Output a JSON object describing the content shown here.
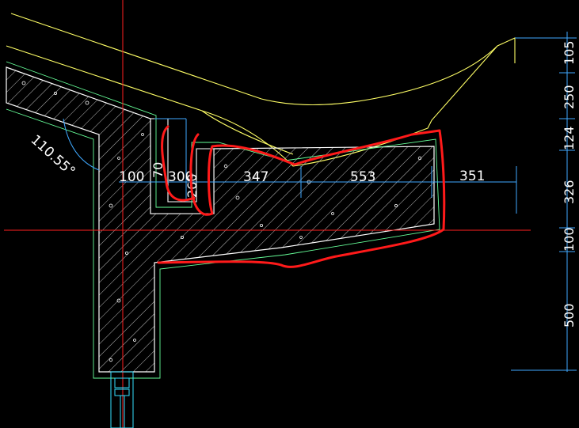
{
  "drawing": {
    "angle_label": "110.55°",
    "dims_horizontal": {
      "d100": "100",
      "d300": "300",
      "d347": "347",
      "d553": "553",
      "d351": "351"
    },
    "dims_vertical_small": {
      "d70": "70",
      "d260": "260"
    },
    "dims_right": [
      "105",
      "250",
      "124",
      "326",
      "100",
      "500"
    ],
    "colors": {
      "background": "#000000",
      "outline": "#ffff66",
      "concrete_edge": "#ffffff",
      "hatch": "#ffffff",
      "inner_line": "#66ff99",
      "dimension": "#3fa9ff",
      "crosshair": "#ff2020",
      "markup": "#ff1a1a",
      "window_frame": "#33e0ff"
    }
  }
}
